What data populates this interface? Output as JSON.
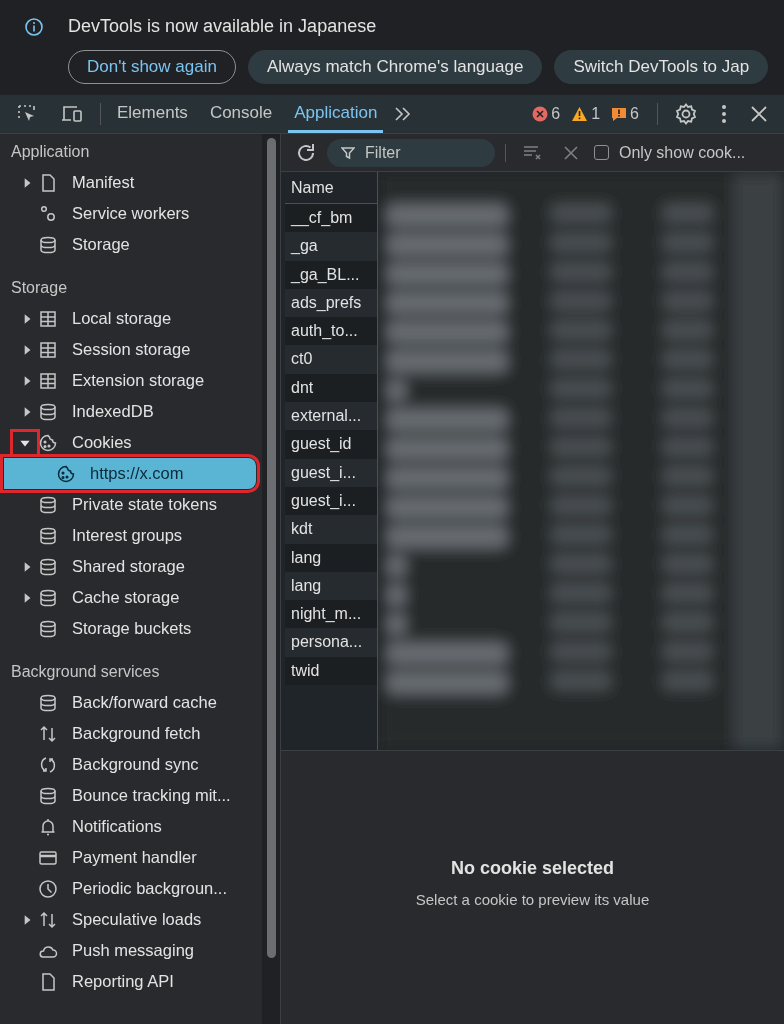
{
  "banner": {
    "message": "DevTools is now available in Japanese",
    "buttons": [
      {
        "label": "Don't show again",
        "kind": "outline"
      },
      {
        "label": "Always match Chrome's language",
        "kind": "filled"
      },
      {
        "label": "Switch DevTools to Jap",
        "kind": "filled"
      }
    ]
  },
  "tabs": [
    {
      "label": "Elements",
      "selected": false
    },
    {
      "label": "Console",
      "selected": false
    },
    {
      "label": "Application",
      "selected": true
    }
  ],
  "counters": {
    "errors": "6",
    "warnings": "1",
    "issues": "6"
  },
  "sidebar": {
    "sections": [
      {
        "title": "Application",
        "items": [
          {
            "label": "Manifest",
            "kind": "file",
            "expanded": false,
            "selected": false
          },
          {
            "label": "Service workers",
            "kind": "gears",
            "selected": false
          },
          {
            "label": "Storage",
            "kind": "database",
            "selected": false
          }
        ]
      },
      {
        "title": "Storage",
        "items": [
          {
            "label": "Local storage",
            "kind": "grid",
            "expanded": false,
            "selected": false
          },
          {
            "label": "Session storage",
            "kind": "grid",
            "expanded": false,
            "selected": false
          },
          {
            "label": "Extension storage",
            "kind": "grid",
            "expanded": false,
            "selected": false
          },
          {
            "label": "IndexedDB",
            "kind": "database",
            "expanded": false,
            "selected": false
          },
          {
            "label": "Cookies",
            "kind": "cookie",
            "expanded": true,
            "selected": false,
            "annotated": true,
            "children": [
              {
                "label": "https://x.com",
                "kind": "cookie",
                "selected": true,
                "annotated": true
              }
            ]
          },
          {
            "label": "Private state tokens",
            "kind": "database",
            "selected": false
          },
          {
            "label": "Interest groups",
            "kind": "database",
            "selected": false
          },
          {
            "label": "Shared storage",
            "kind": "database",
            "expanded": false,
            "selected": false
          },
          {
            "label": "Cache storage",
            "kind": "database",
            "expanded": false,
            "selected": false
          },
          {
            "label": "Storage buckets",
            "kind": "database",
            "selected": false
          }
        ]
      },
      {
        "title": "Background services",
        "items": [
          {
            "label": "Back/forward cache",
            "kind": "database",
            "selected": false
          },
          {
            "label": "Background fetch",
            "kind": "updown",
            "selected": false
          },
          {
            "label": "Background sync",
            "kind": "sync",
            "selected": false
          },
          {
            "label": "Bounce tracking mit...",
            "kind": "database",
            "selected": false
          },
          {
            "label": "Notifications",
            "kind": "bell",
            "selected": false
          },
          {
            "label": "Payment handler",
            "kind": "card",
            "selected": false
          },
          {
            "label": "Periodic backgroun...",
            "kind": "clock",
            "selected": false
          },
          {
            "label": "Speculative loads",
            "kind": "updown",
            "expanded": false,
            "selected": false
          },
          {
            "label": "Push messaging",
            "kind": "cloud",
            "selected": false
          },
          {
            "label": "Reporting API",
            "kind": "file",
            "selected": false
          }
        ]
      }
    ]
  },
  "toolbar": {
    "filter": {
      "placeholder": "Filter"
    },
    "only_show": {
      "label": "Only show cook...",
      "checked": false
    }
  },
  "table": {
    "columns": [
      "Name"
    ],
    "rows": [
      "__cf_bm",
      "_ga",
      "_ga_BL...",
      "ads_prefs",
      "auth_to...",
      "ct0",
      "dnt",
      "external...",
      "guest_id",
      "guest_i...",
      "guest_i...",
      "kdt",
      "lang",
      "lang",
      "night_m...",
      "persona...",
      "twid"
    ]
  },
  "preview": {
    "title": "No cookie selected",
    "text": "Select a cookie to preview its value"
  }
}
